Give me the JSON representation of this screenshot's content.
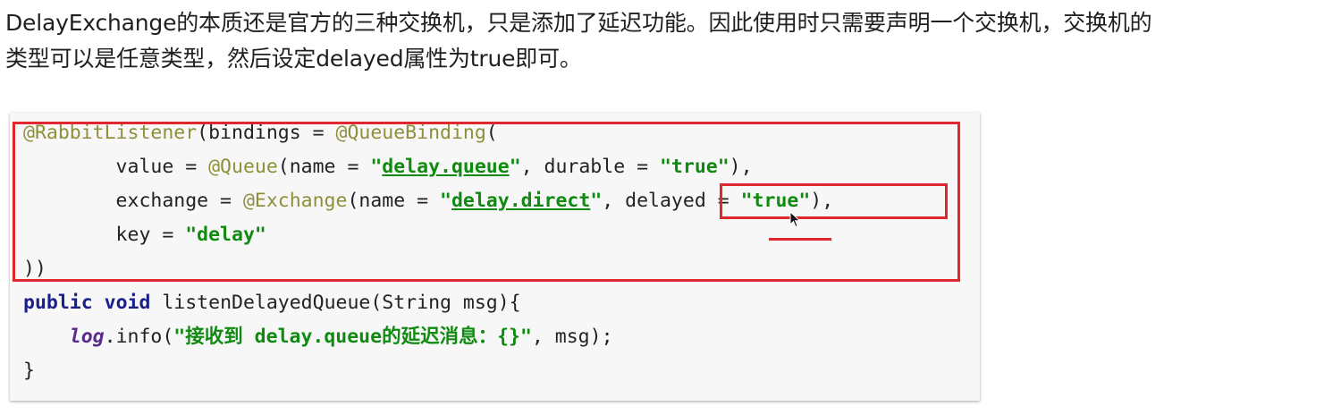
{
  "paragraph": {
    "line1": "DelayExchange的本质还是官方的三种交换机，只是添加了延迟功能。因此使用时只需要声明一个交换机，交换机的",
    "line2": "类型可以是任意类型，然后设定delayed属性为true即可。"
  },
  "code": {
    "l1": {
      "a1": "@RabbitListener",
      "t1": "(bindings = ",
      "a2": "@QueueBinding",
      "t2": "("
    },
    "l2": {
      "t1": "        value = ",
      "a1": "@Queue",
      "t2": "(name = ",
      "q1": "\"",
      "s1": "delay.queue",
      "q2": "\"",
      "t3": ", durable = ",
      "s2": "\"true\"",
      "t4": "),"
    },
    "l3": {
      "t1": "        exchange = ",
      "a1": "@Exchange",
      "t2": "(name = ",
      "q1": "\"",
      "s1": "delay.direct",
      "q2": "\"",
      "t3": ", delayed = ",
      "s2": "\"true\"",
      "t4": "),"
    },
    "l4": {
      "t1": "        key = ",
      "s1": "\"delay\""
    },
    "l5": {
      "t1": "))"
    },
    "l6": {
      "k1": "public",
      "t1": " ",
      "k2": "void",
      "t2": " listenDelayedQueue(String msg){"
    },
    "l7": {
      "t1": "    ",
      "v1": "log",
      "t2": ".info(",
      "s1": "\"接收到 delay.queue的延迟消息：{}\"",
      "t3": ", msg);"
    },
    "l8": {
      "t1": "}"
    }
  },
  "colors": {
    "annotation": "#8f8f3a",
    "string": "#118a11",
    "keyword": "#1a1f8c",
    "highlight_box": "#e0262f"
  }
}
